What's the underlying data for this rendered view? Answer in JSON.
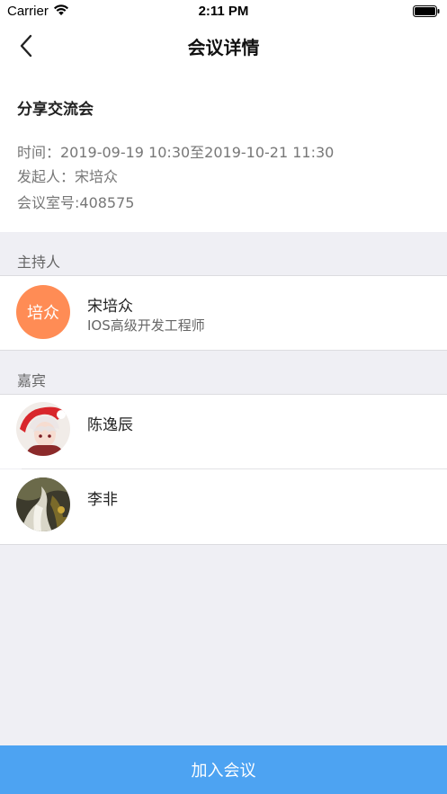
{
  "status_bar": {
    "carrier": "Carrier",
    "time": "2:11 PM"
  },
  "nav": {
    "title": "会议详情"
  },
  "meeting": {
    "name": "分享交流会",
    "time_line": "时间：2019-09-19 10:30至2019-10-21 11:30",
    "initiator_line": "发起人：宋培众",
    "room_line": "会议室号:408575"
  },
  "host_section": {
    "header": "主持人",
    "host": {
      "initials": "培众",
      "name": "宋培众",
      "title": "IOS高级开发工程师",
      "avatar_color": "#ff8c55"
    }
  },
  "guest_section": {
    "header": "嘉宾",
    "guests": [
      {
        "name": "陈逸辰"
      },
      {
        "name": "李非"
      }
    ]
  },
  "join_button": {
    "label": "加入会议",
    "color": "#4da3f2"
  }
}
